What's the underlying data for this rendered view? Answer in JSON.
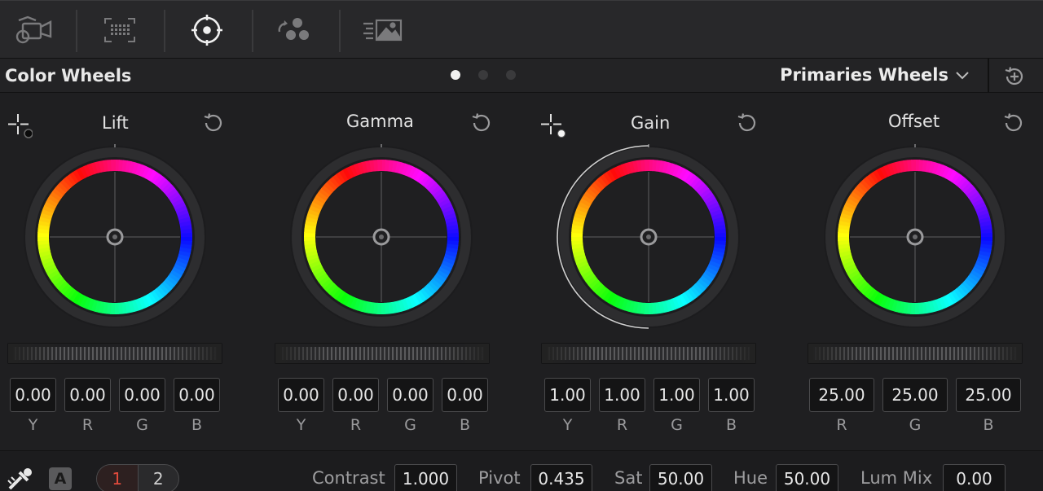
{
  "panel": {
    "title": "Color Wheels",
    "mode": "Primaries Wheels"
  },
  "icons": {
    "toolbar": [
      "camera-raw-icon",
      "color-match-icon",
      "color-wheels-icon",
      "rgb-mixer-icon",
      "motion-effects-icon"
    ],
    "header_reset": "reset-all-icon",
    "mode_chevron": "chevron-down-icon"
  },
  "pages": {
    "count": 3,
    "active": 0
  },
  "wheels": [
    {
      "name": "Lift",
      "values": [
        "0.00",
        "0.00",
        "0.00",
        "0.00"
      ],
      "channels": [
        "Y",
        "R",
        "G",
        "B"
      ]
    },
    {
      "name": "Gamma",
      "values": [
        "0.00",
        "0.00",
        "0.00",
        "0.00"
      ],
      "channels": [
        "Y",
        "R",
        "G",
        "B"
      ]
    },
    {
      "name": "Gain",
      "values": [
        "1.00",
        "1.00",
        "1.00",
        "1.00"
      ],
      "channels": [
        "Y",
        "R",
        "G",
        "B"
      ]
    },
    {
      "name": "Offset",
      "values": [
        "25.00",
        "25.00",
        "25.00"
      ],
      "channels": [
        "R",
        "G",
        "B"
      ]
    }
  ],
  "bottom": {
    "auto_label": "A",
    "page1": "1",
    "page2": "2",
    "contrast_label": "Contrast",
    "contrast": "1.000",
    "pivot_label": "Pivot",
    "pivot": "0.435",
    "sat_label": "Sat",
    "sat": "50.00",
    "hue_label": "Hue",
    "hue": "50.00",
    "lummix_label": "Lum Mix",
    "lummix": "0.00"
  },
  "colors": {
    "background": "#1f1f21",
    "active_page": "#e04a3c",
    "text": "#d6d6d6"
  }
}
